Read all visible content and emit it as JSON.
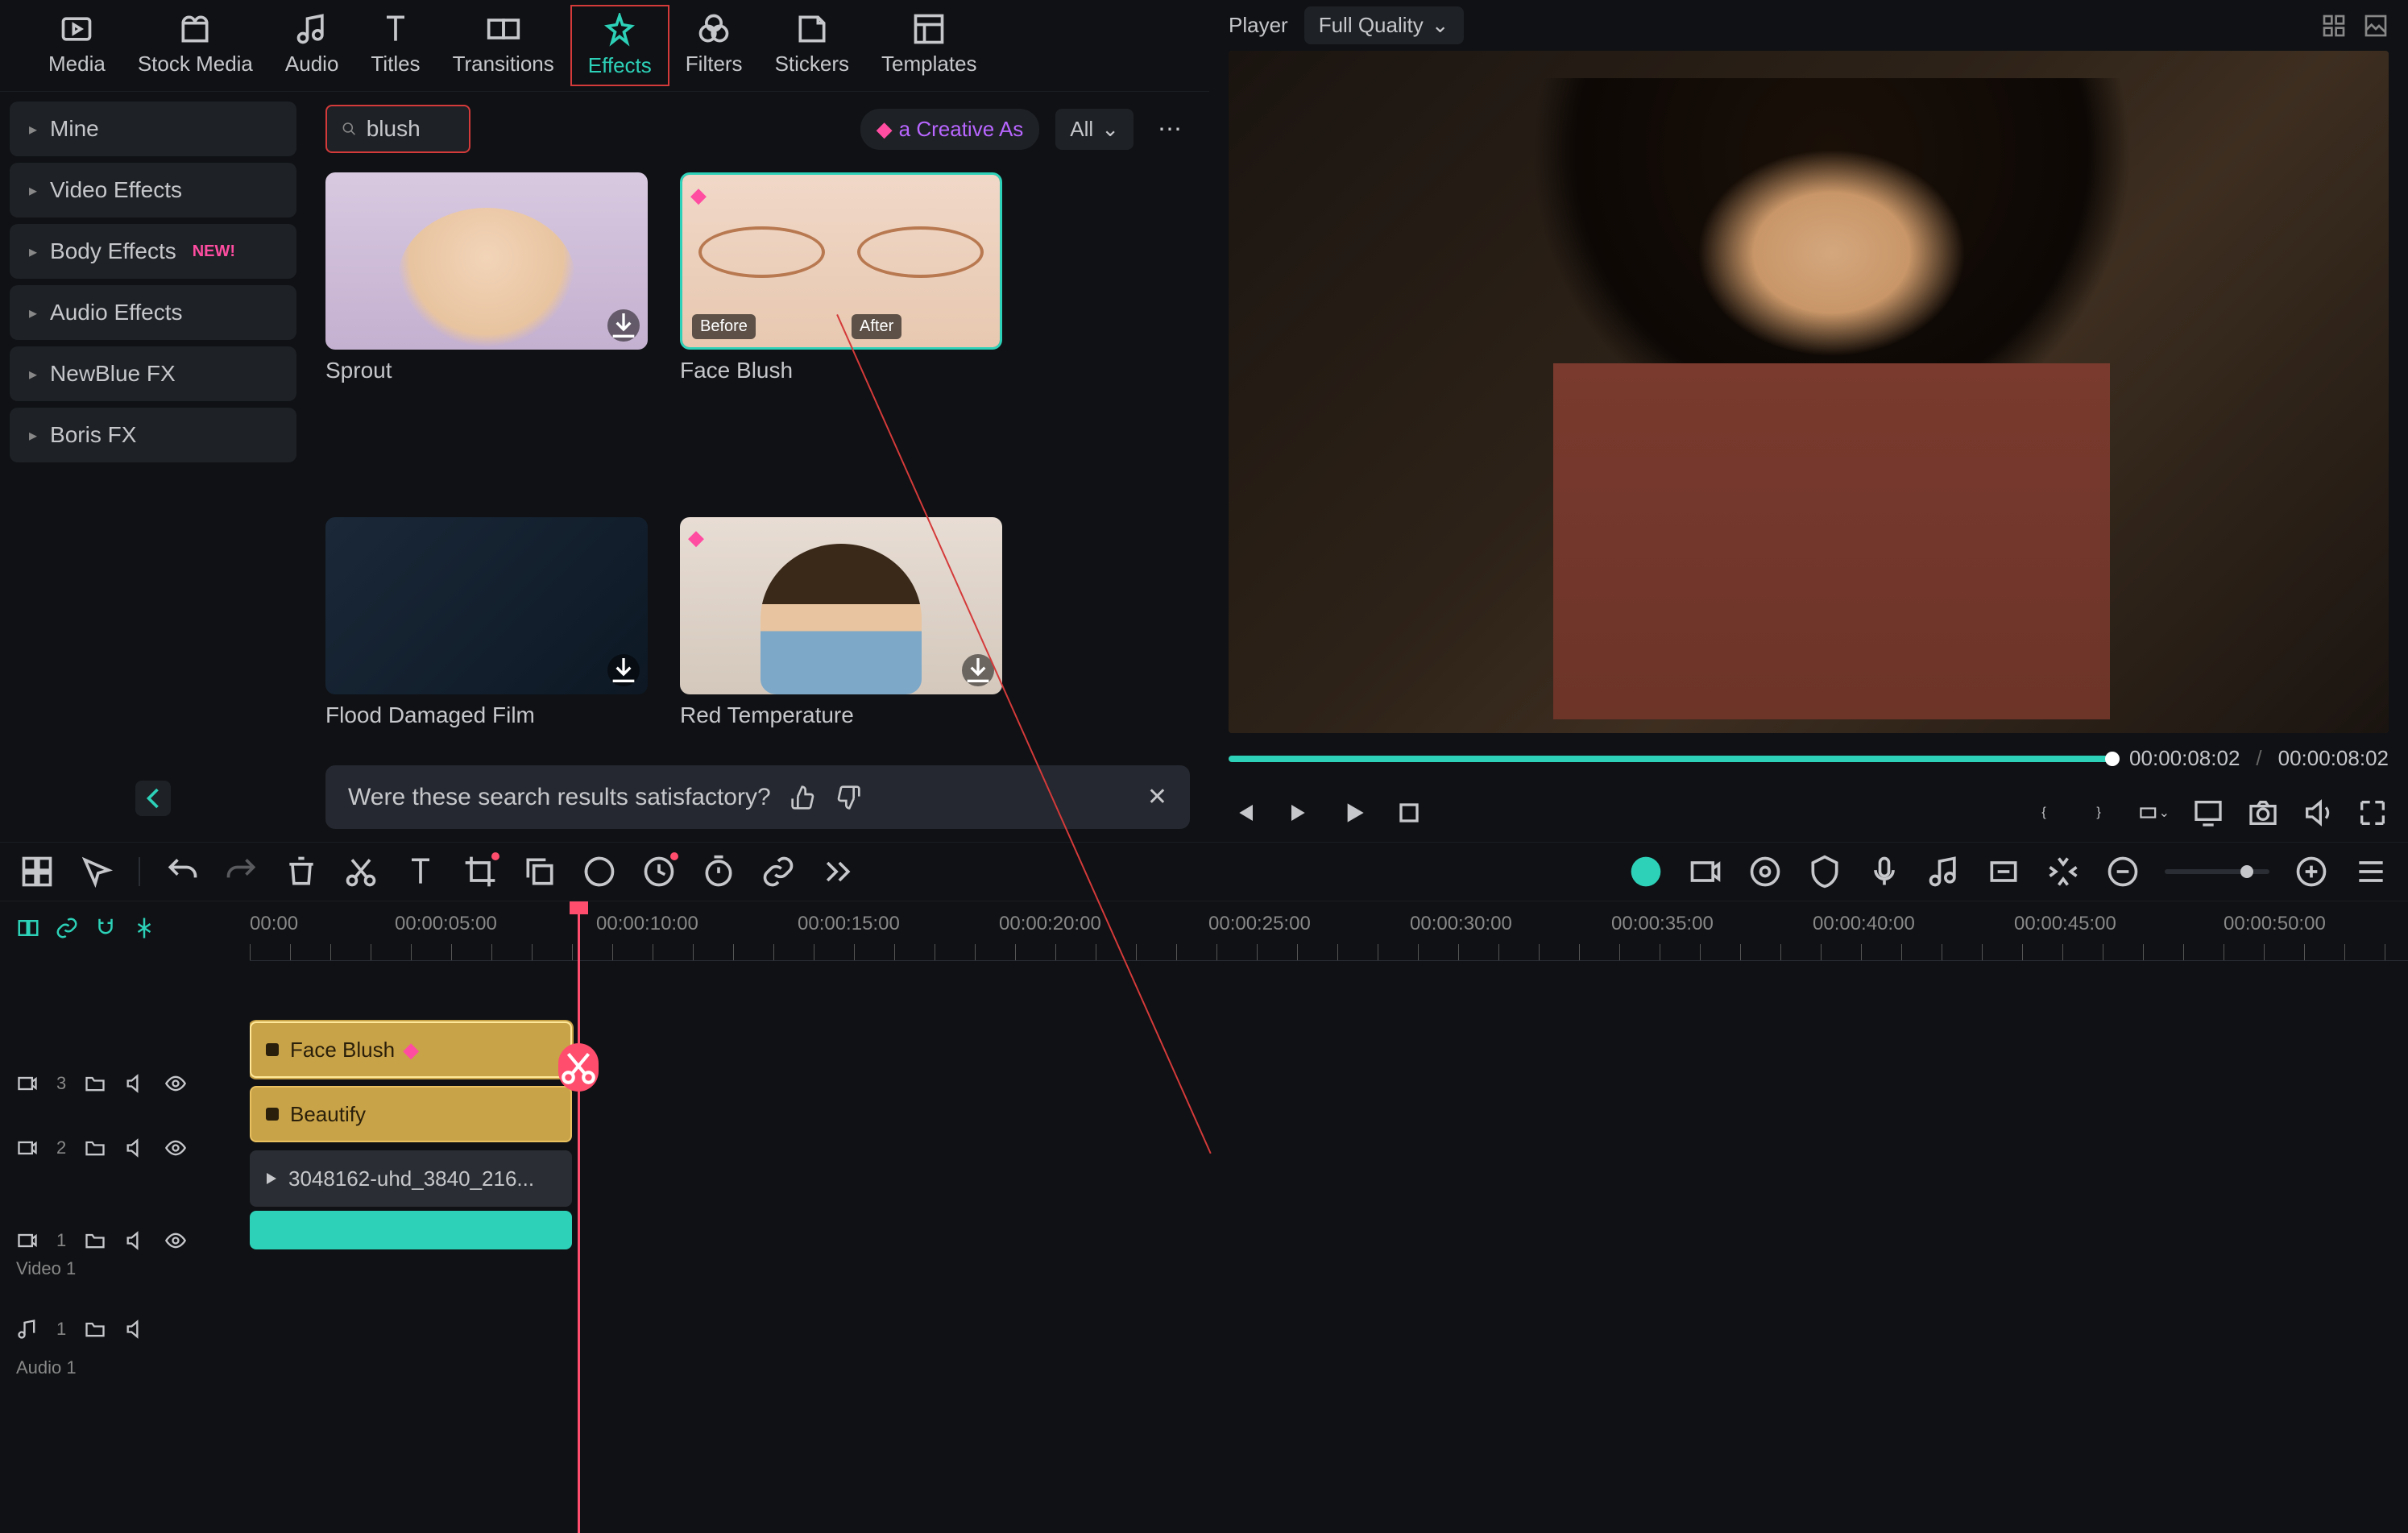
{
  "nav": {
    "media": "Media",
    "stock": "Stock Media",
    "audio": "Audio",
    "titles": "Titles",
    "transitions": "Transitions",
    "effects": "Effects",
    "filters": "Filters",
    "stickers": "Stickers",
    "templates": "Templates"
  },
  "sidebar": {
    "items": [
      "Mine",
      "Video Effects",
      "Body Effects",
      "Audio Effects",
      "NewBlue FX",
      "Boris FX"
    ],
    "new": "NEW!"
  },
  "search": {
    "value": "blush"
  },
  "creative": "a Creative As",
  "all": "All",
  "results": {
    "sprout": "Sprout",
    "faceblush": "Face Blush",
    "flood": "Flood Damaged Film",
    "redtemp": "Red Temperature",
    "before": "Before",
    "after": "After"
  },
  "feedback": {
    "q": "Were these search results satisfactory?"
  },
  "player": {
    "label": "Player",
    "quality": "Full Quality",
    "cur": "00:00:08:02",
    "total": "00:00:08:02"
  },
  "ruler": [
    "00:00",
    "00:00:05:00",
    "00:00:10:00",
    "00:00:15:00",
    "00:00:20:00",
    "00:00:25:00",
    "00:00:30:00",
    "00:00:35:00",
    "00:00:40:00",
    "00:00:45:00",
    "00:00:50:00"
  ],
  "tracks": {
    "t3": "3",
    "t2": "2",
    "t1": "1",
    "video1": "Video 1",
    "a1": "1",
    "audio1": "Audio 1"
  },
  "clips": {
    "fb": "Face Blush",
    "beautify": "Beautify",
    "video": "3048162-uhd_3840_216..."
  }
}
